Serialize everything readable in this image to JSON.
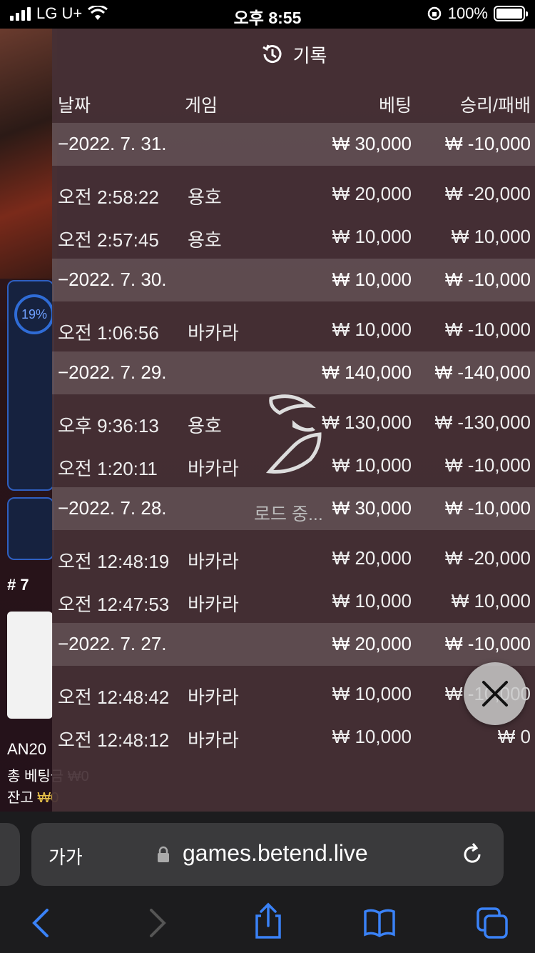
{
  "status_bar": {
    "carrier": "LG U+",
    "time": "오후 8:55",
    "battery": "100%"
  },
  "background_page": {
    "progress_label": "19%",
    "rank_label": "# 7",
    "room_name": "AN20",
    "total_bet_label": "총 베팅금 ₩0",
    "balance_label": "잔고",
    "balance_value": "₩0"
  },
  "history": {
    "title": "기록",
    "columns": {
      "date": "날짜",
      "game": "게임",
      "bet": "베팅",
      "result": "승리/패배"
    },
    "groups": [
      {
        "date": "−2022. 7. 31.",
        "bet": "₩ 30,000",
        "result": "₩ -10,000",
        "items": [
          {
            "time": "오전 2:58:22",
            "game": "용호",
            "bet": "₩ 20,000",
            "result": "₩ -20,000"
          },
          {
            "time": "오전 2:57:45",
            "game": "용호",
            "bet": "₩ 10,000",
            "result": "₩ 10,000"
          }
        ]
      },
      {
        "date": "−2022. 7. 30.",
        "bet": "₩ 10,000",
        "result": "₩ -10,000",
        "items": [
          {
            "time": "오전 1:06:56",
            "game": "바카라",
            "bet": "₩ 10,000",
            "result": "₩ -10,000"
          }
        ]
      },
      {
        "date": "−2022. 7. 29.",
        "bet": "₩ 140,000",
        "result": "₩ -140,000",
        "items": [
          {
            "time": "오후 9:36:13",
            "game": "용호",
            "bet": "₩ 130,000",
            "result": "₩ -130,000"
          },
          {
            "time": "오전 1:20:11",
            "game": "바카라",
            "bet": "₩ 10,000",
            "result": "₩ -10,000"
          }
        ]
      },
      {
        "date": "−2022. 7. 28.",
        "bet": "₩ 30,000",
        "result": "₩ -10,000",
        "items": [
          {
            "time": "오전 12:48:19",
            "game": "바카라",
            "bet": "₩ 20,000",
            "result": "₩ -20,000"
          },
          {
            "time": "오전 12:47:53",
            "game": "바카라",
            "bet": "₩ 10,000",
            "result": "₩ 10,000"
          }
        ]
      },
      {
        "date": "−2022. 7. 27.",
        "bet": "₩ 20,000",
        "result": "₩ -10,000",
        "items": [
          {
            "time": "오전 12:48:42",
            "game": "바카라",
            "bet": "₩ 10,000",
            "result": "₩ -10,000"
          },
          {
            "time": "오전 12:48:12",
            "game": "바카라",
            "bet": "₩ 10,000",
            "result": "₩ 0"
          }
        ]
      }
    ],
    "loading_text": "로드 중..."
  },
  "safari": {
    "text_size_label": "가가",
    "url": "games.betend.live"
  },
  "colors": {
    "accent_blue": "#2f6cd6",
    "overlay_bg": "#46303a",
    "balance_gold": "#e8c14a"
  },
  "icons": {
    "history": "history-icon",
    "close": "close-icon",
    "lock": "lock-icon",
    "reload": "reload-icon",
    "back": "chevron-left-icon",
    "forward": "chevron-right-icon",
    "share": "share-icon",
    "bookmarks": "book-icon",
    "tabs": "tabs-icon"
  }
}
